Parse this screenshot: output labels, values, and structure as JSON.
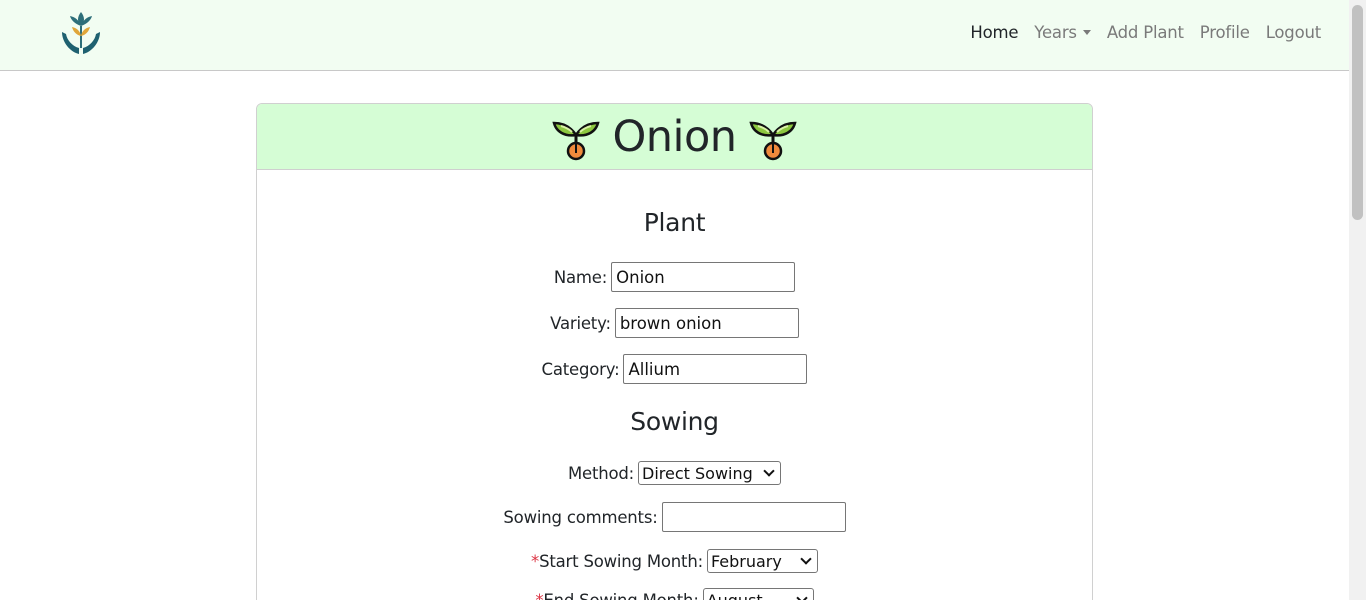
{
  "nav": {
    "items": [
      {
        "label": "Home",
        "active": true
      },
      {
        "label": "Years",
        "dropdown": true
      },
      {
        "label": "Add Plant"
      },
      {
        "label": "Profile"
      },
      {
        "label": "Logout"
      }
    ]
  },
  "card": {
    "title": "Onion",
    "header_icon": "sprout-icon"
  },
  "plant_section": {
    "title": "Plant",
    "name_label": "Name:",
    "name_value": "Onion",
    "variety_label": "Variety:",
    "variety_value": "brown onion",
    "category_label": "Category:",
    "category_value": "Allium"
  },
  "sowing_section": {
    "title": "Sowing",
    "method_label": "Method:",
    "method_value": "Direct Sowing",
    "comments_label": "Sowing comments:",
    "comments_value": "",
    "required_mark": "*",
    "start_label": "Start Sowing Month:",
    "start_value": "February",
    "end_label": "End Sowing Month:",
    "end_value": "August"
  },
  "colors": {
    "navbar_bg": "#f2fdf2",
    "card_header_bg": "#d5fdd5",
    "required": "#dc3545"
  }
}
